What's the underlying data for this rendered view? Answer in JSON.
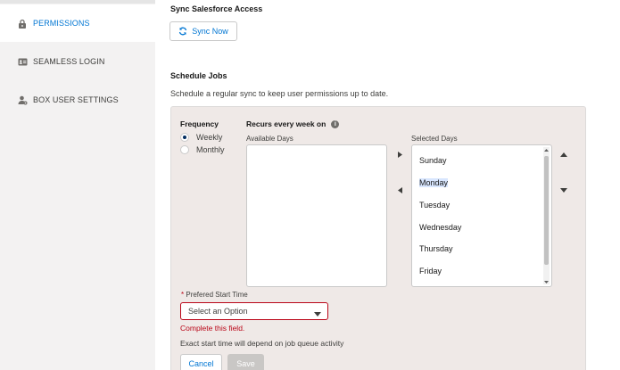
{
  "sidebar": {
    "items": [
      {
        "label": "PERMISSIONS",
        "icon": "lock-icon",
        "active": true
      },
      {
        "label": "SEAMLESS LOGIN",
        "icon": "id-card-icon",
        "active": false
      },
      {
        "label": "BOX USER SETTINGS",
        "icon": "user-settings-icon",
        "active": false
      }
    ]
  },
  "sync": {
    "heading": "Sync Salesforce Access",
    "button_label": "Sync Now",
    "button_icon": "refresh-icon"
  },
  "schedule": {
    "heading": "Schedule Jobs",
    "description": "Schedule a regular sync to keep user permissions up to date.",
    "frequency_label": "Frequency",
    "frequency_options": [
      {
        "label": "Weekly",
        "selected": true
      },
      {
        "label": "Monthly",
        "selected": false
      }
    ],
    "recurs_label": "Recurs every week on",
    "available_label": "Available Days",
    "available_days": [],
    "selected_label": "Selected Days",
    "selected_days": [
      "Sunday",
      "Monday",
      "Tuesday",
      "Wednesday",
      "Thursday",
      "Friday"
    ],
    "highlighted_day": "Monday",
    "start_time_label": "Prefered Start Time",
    "start_time_required_mark": "*",
    "start_time_placeholder": "Select an Option",
    "error_text": "Complete this field.",
    "note": "Exact start time will depend on job queue activity",
    "cancel_label": "Cancel",
    "save_label": "Save"
  },
  "colors": {
    "accent": "#0176d3",
    "error": "#ba0517",
    "panel_bg": "#efe9e7",
    "sidebar_bg": "#f3f2f2"
  }
}
